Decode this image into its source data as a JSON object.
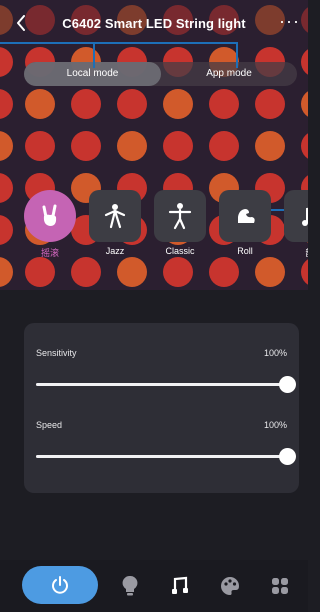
{
  "header": {
    "title": "C6402 Smart LED String light",
    "back_icon": "back-chevron-icon",
    "more_icon": "more-icon",
    "more_glyph": "···"
  },
  "mode_switch": {
    "local_label": "Local mode",
    "app_label": "App mode",
    "selected": "Local mode"
  },
  "music_modes": [
    {
      "label": "摇滚",
      "icon": "rock-hand-icon",
      "active": true
    },
    {
      "label": "Jazz",
      "icon": "jazz-dancer-icon",
      "active": false
    },
    {
      "label": "Classic",
      "icon": "ballet-dancer-icon",
      "active": false
    },
    {
      "label": "Roll",
      "icon": "flexed-arm-icon",
      "active": false
    },
    {
      "label": "韵",
      "icon": "music-note-icon",
      "active": false
    }
  ],
  "sliders": [
    {
      "label": "Sensitivity",
      "value_text": "100%",
      "value": 1.0
    },
    {
      "label": "Speed",
      "value_text": "100%",
      "value": 1.0
    }
  ],
  "bottom_tabs": [
    {
      "name": "power-icon",
      "active": true
    },
    {
      "name": "bulb-icon",
      "active": false
    },
    {
      "name": "music-icon",
      "active": false
    },
    {
      "name": "palette-icon",
      "active": false
    },
    {
      "name": "grid-icon",
      "active": false
    }
  ],
  "colors": {
    "accent_pink": "#c564b4",
    "power_blue": "#4d9be2",
    "led_red": "#d8362f",
    "led_orange": "#e3602b",
    "annotation_blue": "#1d6fb8"
  }
}
